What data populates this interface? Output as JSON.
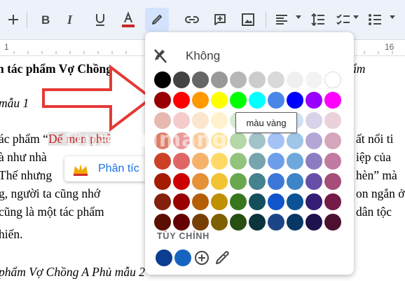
{
  "toolbar": {
    "items": [
      "add-icon",
      "bold-icon",
      "italic-icon",
      "underline-icon",
      "text-color-icon",
      "highlight-pen-icon",
      "link-icon",
      "add-comment-icon",
      "insert-image-icon",
      "align-icon",
      "line-spacing-icon",
      "checklist-icon",
      "bulleted-list-icon"
    ],
    "text_color_underline": "#c62828"
  },
  "ruler": {
    "numbers": [
      "1",
      "16"
    ]
  },
  "document": {
    "line1": "n tác phẩm Vợ Chồng",
    "line1_right": "ẩm",
    "line2": "mẫu 1",
    "line3_pre": "ác phẩm “",
    "line3_red": "Dế mèn phiê",
    "line3_right": "ất nổi ti",
    "line4": "à như nhà",
    "line4_right": "iệp của",
    "line5": "Thế nhưng",
    "line5_right": "hèn” mà",
    "line6": "g, người ta cũng nhớ",
    "line6_right": "on ngắn ở",
    "line7": "cũng là một tác phẩm",
    "line7_right": "dân tộc",
    "line8": "hiến.",
    "line9": "phẩm Vợ Chồng A Phủ mẫu 2"
  },
  "analysis_chip": {
    "label": "Phân tíc"
  },
  "popup": {
    "none_label": "Không",
    "tooltip": "màu vàng",
    "custom_label": "TÙY CHỈNH",
    "custom_colors": [
      "#0b3d91",
      "#1565c0"
    ],
    "rows": [
      [
        "#000000",
        "#434343",
        "#666666",
        "#999999",
        "#b7b7b7",
        "#cccccc",
        "#d9d9d9",
        "#efefef",
        "#f3f3f3",
        "#ffffff"
      ],
      [
        "#980000",
        "#ff0000",
        "#ff9900",
        "#ffff00",
        "#00ff00",
        "#00ffff",
        "#4a86e8",
        "#0000ff",
        "#9900ff",
        "#ff00ff"
      ],
      [
        "#e6b8af",
        "#f4cccc",
        "#fce5cd",
        "#fff2cc",
        "#d9ead3",
        "#d0e0e3",
        "#c9daf8",
        "#cfe2f3",
        "#d9d2e9",
        "#ead1dc"
      ],
      [
        "#dd7e6b",
        "#ea9999",
        "#f9cb9c",
        "#ffe599",
        "#b6d7a8",
        "#a2c4c9",
        "#a4c2f4",
        "#9fc5e8",
        "#b4a7d6",
        "#d5a6bd"
      ],
      [
        "#cc4125",
        "#e06666",
        "#f6b26b",
        "#ffd966",
        "#93c47d",
        "#76a5af",
        "#6d9eeb",
        "#6fa8dc",
        "#8e7cc3",
        "#c27ba0"
      ],
      [
        "#a61c00",
        "#cc0000",
        "#e69138",
        "#f1c232",
        "#6aa84f",
        "#45818e",
        "#3c78d8",
        "#3d85c6",
        "#674ea7",
        "#a64d79"
      ],
      [
        "#85200c",
        "#990000",
        "#b45f06",
        "#bf9000",
        "#38761d",
        "#134f5c",
        "#1155cc",
        "#0b5394",
        "#351c75",
        "#741b47"
      ],
      [
        "#5b0f00",
        "#660000",
        "#783f04",
        "#7f6000",
        "#274e13",
        "#0c343d",
        "#1c4587",
        "#073763",
        "#20124d",
        "#4c1130"
      ]
    ]
  }
}
